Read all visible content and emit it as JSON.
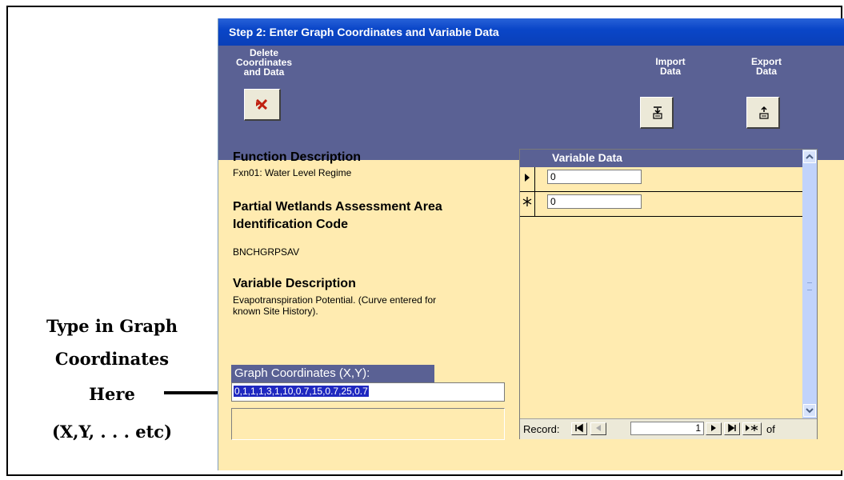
{
  "callout": {
    "line1": "Type in Graph",
    "line2": "Coordinates",
    "line3": "Here",
    "line4": "(X,Y, . . . etc)"
  },
  "window": {
    "title": "Step 2: Enter Graph Coordinates and Variable Data"
  },
  "toolbar": {
    "delete_label_1": "Delete",
    "delete_label_2": "Coordinates",
    "delete_label_3": "and Data",
    "import_label_1": "Import",
    "import_label_2": "Data",
    "export_label_1": "Export",
    "export_label_2": "Data",
    "delete_icon": "delete-x-icon",
    "import_icon": "import-arrow-icon",
    "export_icon": "export-arrow-icon"
  },
  "form": {
    "function_heading": "Function Description",
    "function_value": "Fxn01: Water Level Regime",
    "pwaa_heading_1": "Partial Wetlands Assessment Area",
    "pwaa_heading_2": "Identification Code",
    "pwaa_value": "BNCHGRPSAV",
    "variable_heading": "Variable Description",
    "variable_value_1": "Evapotranspiration Potential.  (Curve entered for",
    "variable_value_2": "known Site History).",
    "coords_label": "Graph Coordinates (X,Y):",
    "coords_value": "0,1,1,1,3,1,10,0.7,15,0.7,25,0.7"
  },
  "subform": {
    "header": "Variable Data",
    "rows": [
      {
        "selector": "current-record-icon",
        "value": "0"
      },
      {
        "selector": "new-record-icon",
        "value": "0"
      }
    ],
    "nav": {
      "record_label": "Record:",
      "record_number": "1",
      "of_label": "of"
    }
  },
  "colors": {
    "header_bg": "#5a6194",
    "form_bg": "#ffebb0",
    "titlebar": "#0a46c8",
    "selection": "#1f28c0"
  }
}
